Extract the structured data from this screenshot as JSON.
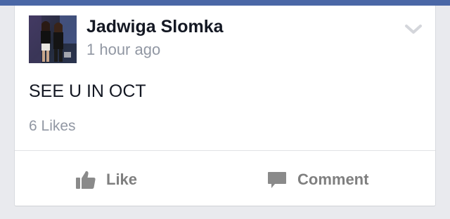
{
  "post": {
    "author": "Jadwiga Slomka",
    "timestamp": "1 hour ago",
    "text": "SEE U IN OCT",
    "likes_count": "6 Likes"
  },
  "actions": {
    "like_label": "Like",
    "comment_label": "Comment"
  },
  "icons": {
    "menu": "chevron-down-icon",
    "like": "thumbs-up-icon",
    "comment": "speech-bubble-icon"
  },
  "colors": {
    "top_bar": "#4a67a6",
    "author_text": "#141823",
    "secondary_text": "#9197a3",
    "action_text": "#7f7f7f"
  }
}
